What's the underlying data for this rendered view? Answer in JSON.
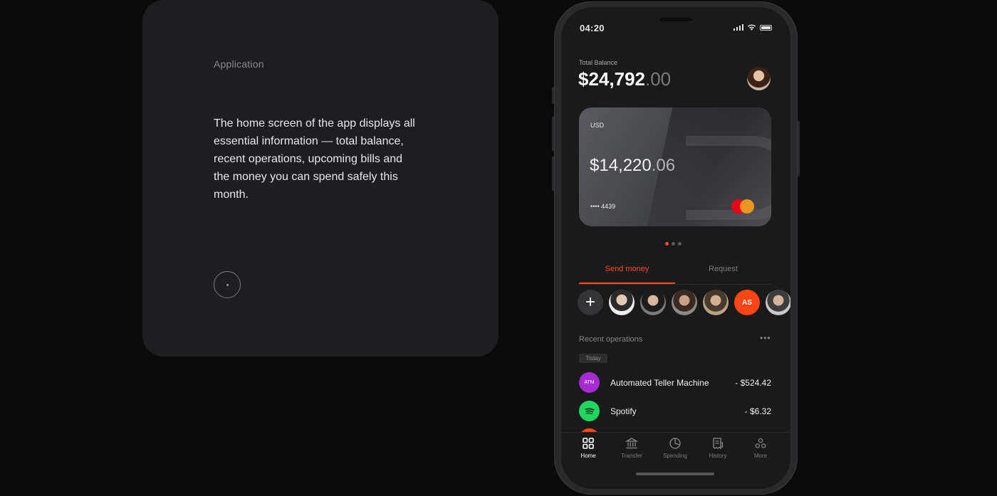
{
  "info": {
    "label": "Application",
    "description": "The home screen of the app displays all essential information — total balance, recent operations, upcoming bills and the money you can spend safely this month."
  },
  "status": {
    "time": "04:20"
  },
  "balance": {
    "label": "Total Balance",
    "whole": "$24,792",
    "cents": ".00"
  },
  "card": {
    "currency": "USD",
    "amount_whole": "$14,220",
    "amount_cents": ".06",
    "number": "•••• 4439"
  },
  "carousel": {
    "pages": 3,
    "active": 1
  },
  "tabs": {
    "send": "Send money",
    "request": "Request"
  },
  "contacts": {
    "add": "+",
    "initials": "AS"
  },
  "operations": {
    "title": "Recent operations",
    "more": "•••",
    "today": "Today",
    "items": [
      {
        "icon_text": "ATM",
        "name": "Automated Teller Machine",
        "amount": "- $524.42",
        "color": "#a62bd1"
      },
      {
        "icon": "spotify-icon",
        "name": "Spotify",
        "amount": "- $6.32",
        "color": "#1ed760"
      }
    ]
  },
  "nav": {
    "items": [
      {
        "label": "Home",
        "icon": "grid-icon"
      },
      {
        "label": "Transfer",
        "icon": "bank-icon"
      },
      {
        "label": "Spending",
        "icon": "pie-chart-icon"
      },
      {
        "label": "History",
        "icon": "receipt-icon"
      },
      {
        "label": "More",
        "icon": "more-icon"
      }
    ]
  },
  "colors": {
    "accent": "#ff4b1f",
    "background": "#0b0b0b",
    "card_panel": "#1e1e21"
  }
}
